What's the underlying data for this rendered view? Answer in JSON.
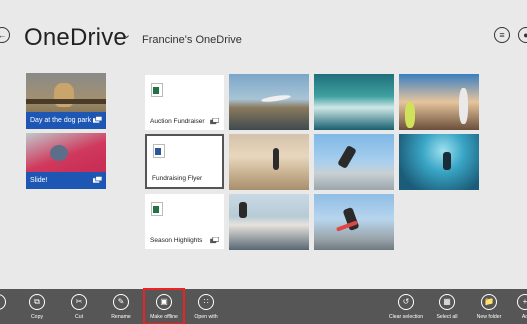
{
  "header": {
    "title": "OneDrive",
    "title_chevron_icon": "chevron-down-icon",
    "subtitle": "Francine's OneDrive",
    "back_icon": "back-arrow-icon",
    "list_view_icon": "list-icon",
    "account_icon": "account-icon"
  },
  "folders": [
    {
      "label": "Day at the dog park",
      "icon": "offline-icon"
    },
    {
      "label": "Slide!",
      "icon": "offline-icon"
    }
  ],
  "documents": [
    {
      "label": "Auction Fundraiser",
      "file_icon": "excel-file-icon",
      "color": "#217346"
    },
    {
      "label": "Fundraising Flyer",
      "file_icon": "word-file-icon",
      "color": "#2b5797"
    },
    {
      "label": "Season Highlights",
      "file_icon": "excel-file-icon",
      "color": "#217346"
    }
  ],
  "photos": [
    {
      "subject": "surfer-on-beach"
    },
    {
      "subject": "wave-surfing"
    },
    {
      "subject": "group-with-boards"
    },
    {
      "subject": "surfer-walking-beach"
    },
    {
      "subject": "skateboarder-jump"
    },
    {
      "subject": "skater-in-bowl"
    },
    {
      "subject": "surfer-coast"
    },
    {
      "subject": "skateboarder-ramp"
    }
  ],
  "appbar": {
    "left": [
      {
        "label": "",
        "icon": "partial-icon"
      },
      {
        "label": "Copy",
        "icon": "copy-icon"
      },
      {
        "label": "Cut",
        "icon": "cut-icon"
      },
      {
        "label": "Rename",
        "icon": "rename-icon"
      },
      {
        "label": "Make offline",
        "icon": "make-offline-icon",
        "highlighted": true
      },
      {
        "label": "Open with",
        "icon": "open-with-icon"
      }
    ],
    "right": [
      {
        "label": "Clear selection",
        "icon": "clear-selection-icon"
      },
      {
        "label": "Select all",
        "icon": "select-all-icon"
      },
      {
        "label": "New folder",
        "icon": "new-folder-icon"
      },
      {
        "label": "Ad",
        "icon": "add-icon"
      }
    ]
  },
  "colors": {
    "background": "#e9e9e9",
    "folder_caption": "#1e56b4",
    "appbar": "#565656",
    "highlight": "#ee2222"
  }
}
